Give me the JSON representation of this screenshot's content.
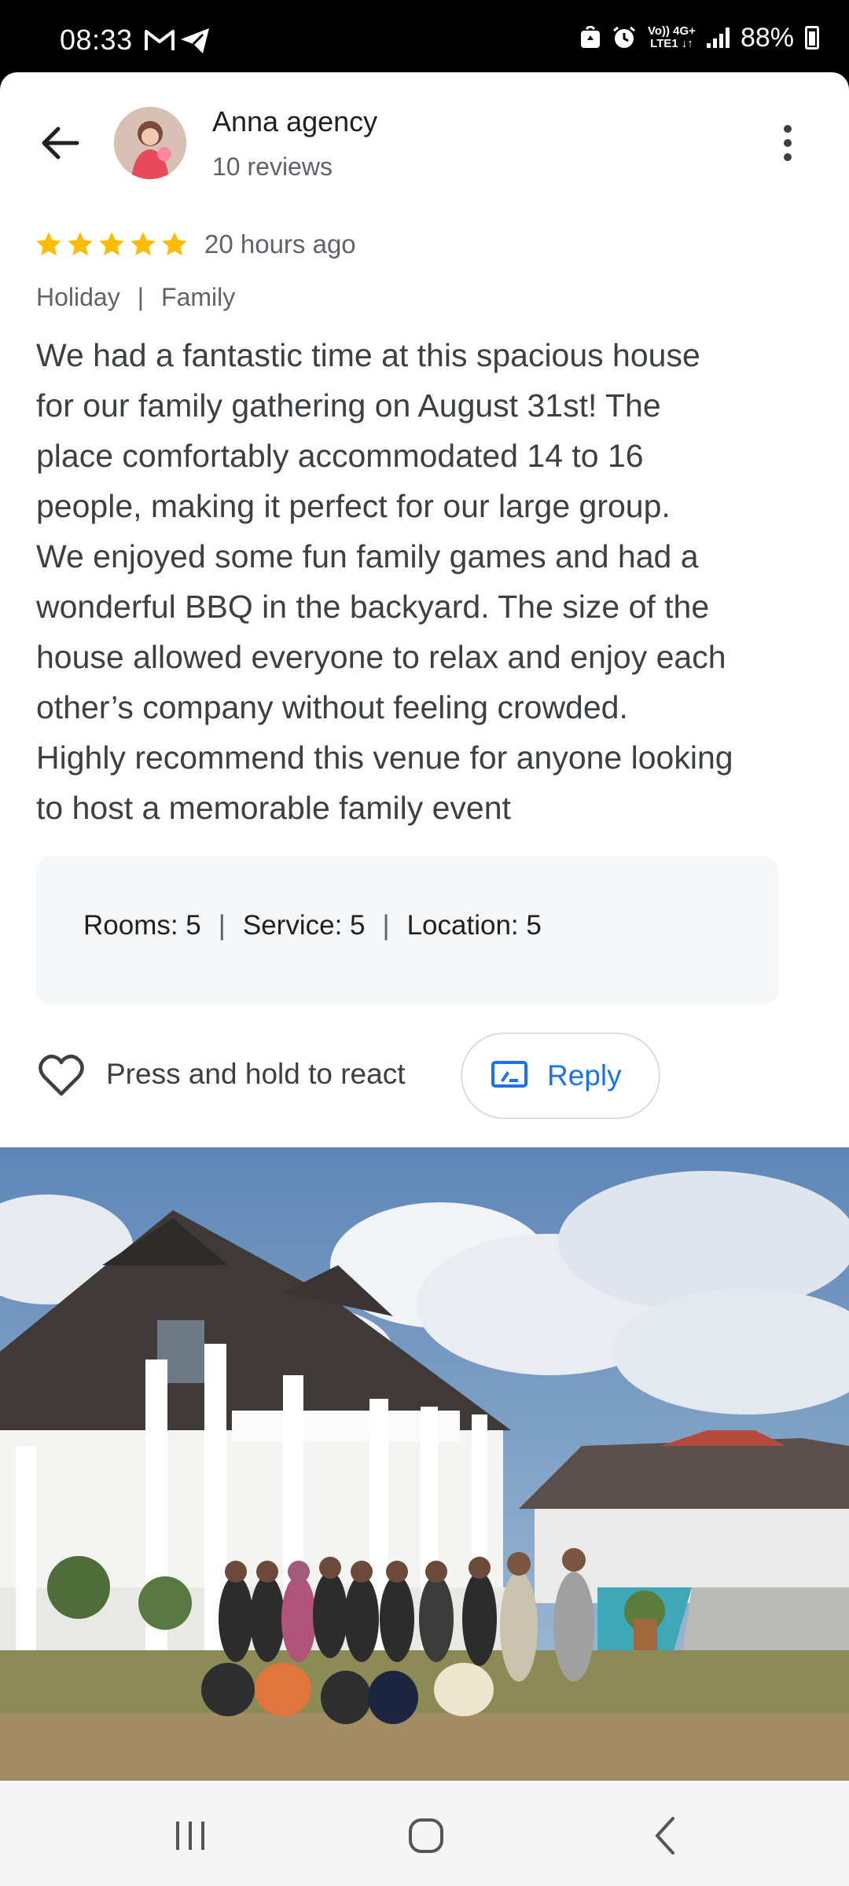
{
  "status_bar": {
    "time": "08:33",
    "network_top": "Vo)) 4G+",
    "network_bottom": "LTE1 ↓↑",
    "battery": "88%"
  },
  "header": {
    "author_name": "Anna agency",
    "author_reviews": "10 reviews"
  },
  "review": {
    "rating": 5,
    "star_color": "#fbbc04",
    "time_ago": "20 hours ago",
    "tags": [
      "Holiday",
      "|",
      "Family"
    ],
    "lines": [
      "We had a fantastic time at this spacious house",
      "for our family gathering on August 31st! The",
      "place comfortably accommodated 14 to 16",
      "people, making it perfect for our large group.",
      "We enjoyed some fun family games and had a",
      "wonderful BBQ in the backyard. The size of the",
      "house allowed everyone to relax and enjoy each",
      "other’s company without feeling crowded.",
      "Highly recommend this venue for anyone looking",
      "to host a memorable family event"
    ]
  },
  "ratings": {
    "rooms": "Rooms: 5",
    "service": "Service: 5",
    "location": "Location: 5",
    "separator": "|"
  },
  "actions": {
    "react_label": "Press and hold to react",
    "reply_label": "Reply",
    "accent": "#1a73e8"
  },
  "photo": {
    "icon": "review-photo"
  },
  "navbar": {
    "recents_icon": "recents-icon",
    "home_icon": "home-icon",
    "back_icon": "back-icon"
  }
}
